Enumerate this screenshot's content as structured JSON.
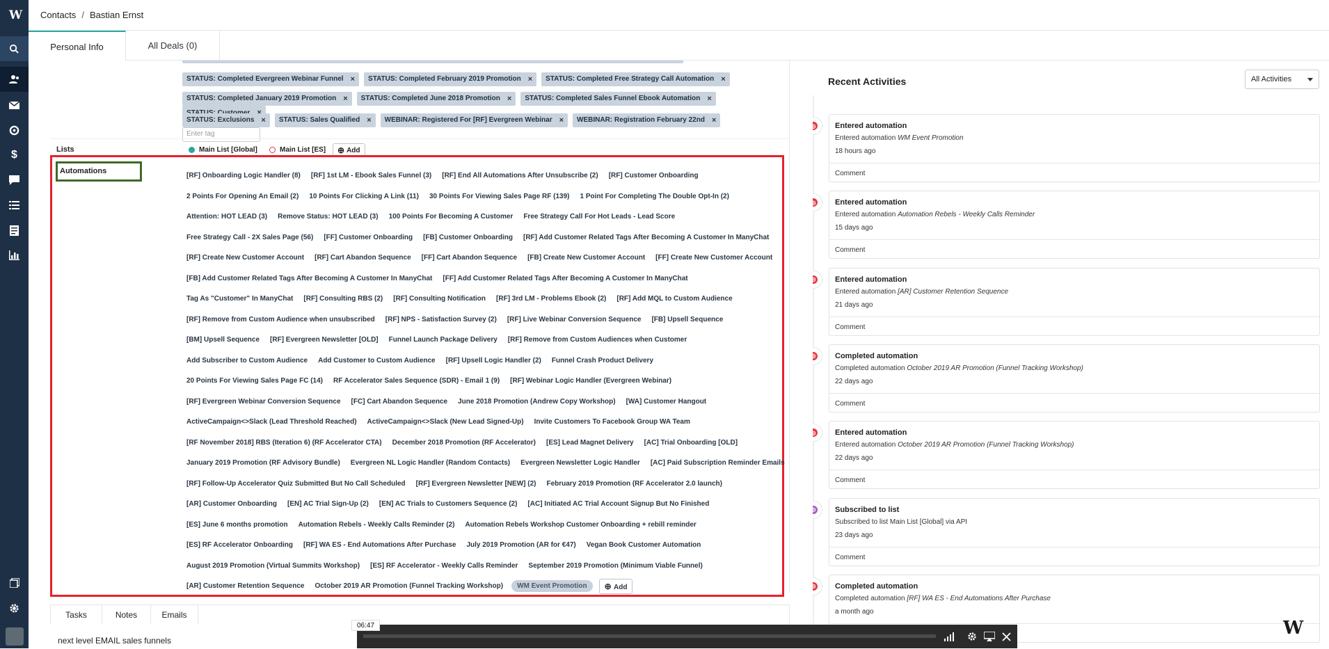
{
  "breadcrumb": {
    "root": "Contacts",
    "separator": "/",
    "current": "Bastian Ernst"
  },
  "tabs": {
    "personal": "Personal Info",
    "deals": "All Deals (0)"
  },
  "tags": {
    "rows": [
      [
        "STATUS: Completed Evergreen Webinar Funnel",
        "STATUS: Completed February 2019 Promotion",
        "STATUS: Completed Free Strategy Call Automation"
      ],
      [
        "STATUS: Completed January 2019 Promotion",
        "STATUS: Completed June 2018 Promotion",
        "STATUS: Completed Sales Funnel Ebook Automation",
        "STATUS: Customer"
      ],
      [
        "STATUS: Exclusions",
        "STATUS: Sales Qualified",
        "WEBINAR: Registered For [RF] Evergreen Webinar",
        "WEBINAR: Registration February 22nd"
      ]
    ],
    "remove_glyph": "×",
    "input_placeholder": "Enter tag"
  },
  "lists": {
    "label": "Lists",
    "items": [
      {
        "name": "Main List [Global]",
        "status": "subscribed",
        "color": "#2aa7a1"
      },
      {
        "name": "Main List [ES]",
        "status": "unsubscribed",
        "color": "#e8353b"
      }
    ],
    "add_label": "Add"
  },
  "automations": {
    "label": "Automations",
    "rows": [
      [
        "[RF] Onboarding Logic Handler (8)",
        "[RF] 1st LM - Ebook Sales Funnel (3)",
        "[RF] End All Automations After Unsubscribe (2)",
        "[RF] Customer Onboarding"
      ],
      [
        "2 Points For Opening An Email (2)",
        "10 Points For Clicking A Link (11)",
        "30 Points For Viewing Sales Page RF (139)",
        "1 Point For Completing The Double Opt-In (2)"
      ],
      [
        "Attention: HOT LEAD (3)",
        "Remove Status: HOT LEAD (3)",
        "100 Points For Becoming A Customer",
        "Free Strategy Call For Hot Leads - Lead Score"
      ],
      [
        "Free Strategy Call - 2X Sales Page (56)",
        "[FF] Customer Onboarding",
        "[FB] Customer Onboarding",
        "[RF] Add Customer Related Tags After Becoming A Customer In ManyChat"
      ],
      [
        "[RF] Create New Customer Account",
        "[RF] Cart Abandon Sequence",
        "[FF] Cart Abandon Sequence",
        "[FB] Create New Customer Account",
        "[FF] Create New Customer Account"
      ],
      [
        "[FB] Add Customer Related Tags After Becoming A Customer In ManyChat",
        "[FF] Add Customer Related Tags After Becoming A Customer In ManyChat"
      ],
      [
        "Tag As \"Customer\" In ManyChat",
        "[RF] Consulting RBS (2)",
        "[RF] Consulting Notification",
        "[RF] 3rd LM - Problems Ebook (2)",
        "[RF] Add MQL to Custom Audience"
      ],
      [
        "[RF] Remove from Custom Audience when unsubscribed",
        "[RF] NPS - Satisfaction Survey (2)",
        "[RF] Live Webinar Conversion Sequence",
        "[FB] Upsell Sequence"
      ],
      [
        "[BM] Upsell Sequence",
        "[RF] Evergreen Newsletter [OLD]",
        "Funnel Launch Package Delivery",
        "[RF] Remove from Custom Audiences when Customer"
      ],
      [
        "Add Subscriber to Custom Audience",
        "Add Customer to Custom Audience",
        "[RF] Upsell Logic Handler (2)",
        "Funnel Crash Product Delivery"
      ],
      [
        "20 Points For Viewing Sales Page FC (14)",
        "RF Accelerator Sales Sequence (SDR) - Email 1 (9)",
        "[RF] Webinar Logic Handler (Evergreen Webinar)"
      ],
      [
        "[RF] Evergreen Webinar Conversion Sequence",
        "[FC] Cart Abandon Sequence",
        "June 2018 Promotion (Andrew Copy Workshop)",
        "[WA] Customer Hangout"
      ],
      [
        "ActiveCampaign<>Slack (Lead Threshold Reached)",
        "ActiveCampaign<>Slack (New Lead Signed-Up)",
        "Invite Customers To Facebook Group WA Team"
      ],
      [
        "[RF November 2018] RBS (Iteration 6) (RF Accelerator CTA)",
        "December 2018 Promotion (RF Accelerator)",
        "[ES] Lead Magnet Delivery",
        "[AC] Trial Onboarding [OLD]"
      ],
      [
        "January 2019 Promotion (RF Advisory Bundle)",
        "Evergreen NL Logic Handler (Random Contacts)",
        "Evergreen Newsletter Logic Handler",
        "[AC] Paid Subscription Reminder Emails"
      ],
      [
        "[RF] Follow-Up Accelerator Quiz Submitted But No Call Scheduled",
        "[RF] Evergreen Newsletter [NEW] (2)",
        "February 2019 Promotion (RF Accelerator 2.0 launch)"
      ],
      [
        "[AR] Customer Onboarding",
        "[EN] AC Trial Sign-Up (2)",
        "[EN] AC Trials to Customers Sequence (2)",
        "[AC] Initiated AC Trial Account Signup But No Finished"
      ],
      [
        "[ES] June 6 months promotion",
        "Automation Rebels - Weekly Calls Reminder (2)",
        "Automation Rebels Workshop Customer Onboarding + rebill reminder"
      ],
      [
        "[ES] RF Accelerator Onboarding",
        "[RF] WA ES - End Automations After Purchase",
        "July 2019 Promotion (AR for €47)",
        "Vegan Book Customer Automation"
      ],
      [
        "August 2019 Promotion (Virtual Summits Workshop)",
        "[ES] RF Accelerator - Weekly Calls Reminder",
        "September 2019 Promotion (Minimum Viable Funnel)"
      ],
      [
        "[AR] Customer Retention Sequence",
        "October 2019 AR Promotion (Funnel Tracking Workshop)",
        "WM Event Promotion"
      ]
    ],
    "add_label": "Add"
  },
  "bottom_tabs": {
    "tasks": "Tasks",
    "notes": "Notes",
    "emails": "Emails"
  },
  "note_text": "next level EMAIL sales funnels",
  "activities": {
    "title": "Recent Activities",
    "filter": "All Activities",
    "comment_label": "Comment",
    "items": [
      {
        "title": "Entered automation",
        "prefix": "Entered automation ",
        "name": "WM Event Promotion",
        "ago": "18 hours ago",
        "kind": "automation",
        "color": "#e8353b"
      },
      {
        "title": "Entered automation",
        "prefix": "Entered automation ",
        "name": "Automation Rebels - Weekly Calls Reminder",
        "ago": "15 days ago",
        "kind": "automation",
        "color": "#e8353b"
      },
      {
        "title": "Entered automation",
        "prefix": "Entered automation ",
        "name": "[AR] Customer Retention Sequence",
        "ago": "21 days ago",
        "kind": "automation",
        "color": "#e8353b"
      },
      {
        "title": "Completed automation",
        "prefix": "Completed automation ",
        "name": "October 2019 AR Promotion (Funnel Tracking Workshop)",
        "ago": "22 days ago",
        "kind": "automation",
        "color": "#e8353b"
      },
      {
        "title": "Entered automation",
        "prefix": "Entered automation ",
        "name": "October 2019 AR Promotion (Funnel Tracking Workshop)",
        "ago": "22 days ago",
        "kind": "automation",
        "color": "#e8353b"
      },
      {
        "title": "Subscribed to list",
        "prefix": "Subscribed to list Main List [Global] via API",
        "name": "",
        "ago": "23 days ago",
        "kind": "list",
        "color": "#a657c8"
      },
      {
        "title": "Completed automation",
        "prefix": "Completed automation ",
        "name": "[RF] WA ES - End Automations After Purchase",
        "ago": "a month ago",
        "kind": "automation",
        "color": "#e8353b"
      }
    ]
  },
  "video": {
    "time": "06:47",
    "progress": 0.0
  }
}
